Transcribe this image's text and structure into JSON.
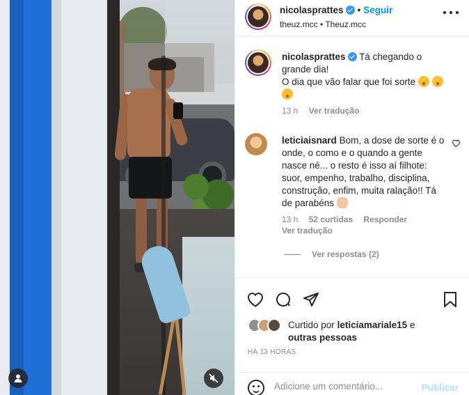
{
  "header": {
    "username": "nicolasprattes",
    "separator": "•",
    "follow_label": "Seguir",
    "subtitle": "theuz.mcc • Theuz.mcc"
  },
  "caption": {
    "username": "nicolasprattes",
    "text_line1": "Tá chegando o grande dia!",
    "text_line2": "O dia que vão falar que foi sorte",
    "time": "13 h",
    "translate_label": "Ver tradução"
  },
  "comment": {
    "username": "leticiaisnard",
    "text": "Bom, a dose de sorte é o onde, o como e o quando a gente nasce né... o resto é isso aí filhote: suor, empenho, trabalho, disciplina, construção, enfim, muita ralação!! Tá de parabéns",
    "time": "13 h",
    "likes": "52 curtidas",
    "reply_label": "Responder",
    "translate_label": "Ver tradução",
    "view_replies": "Ver respostas (2)"
  },
  "likes": {
    "prefix": "Curtido por",
    "user": "leticiamariale15",
    "connector": "e",
    "others": "outras pessoas"
  },
  "timestamp": "HÁ 13 HORAS",
  "add_comment": {
    "placeholder": "Adicione um comentário...",
    "publish_label": "Publicar"
  },
  "icons": {
    "heart": "heart-icon",
    "comment": "comment-icon",
    "share": "share-icon",
    "save": "bookmark-icon",
    "more": "more-icon",
    "verified": "verified-icon",
    "emoji": "emoji-icon",
    "mute": "mute-icon",
    "user": "user-tag-icon"
  },
  "colors": {
    "accent": "#0095f6",
    "verified": "#3897f0",
    "muted_text": "#8e8e8e",
    "publish_disabled": "#b2dffc"
  }
}
